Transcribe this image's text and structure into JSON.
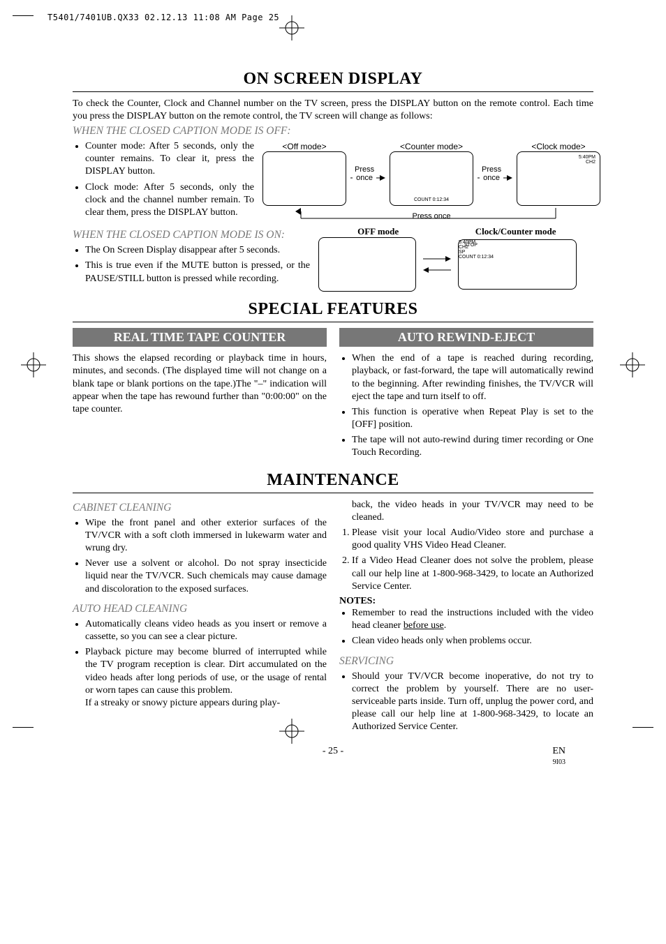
{
  "header": {
    "proof_line": "T5401/7401UB.QX33  02.12.13  11:08 AM  Page 25"
  },
  "sections": {
    "osd": {
      "title": "ON SCREEN DISPLAY",
      "intro": "To check the Counter, Clock and Channel number on the TV screen, press the DISPLAY button on the remote control. Each time you press the DISPLAY button on the remote control, the TV screen will change as follows:",
      "cc_off_heading": "WHEN THE CLOSED CAPTION MODE IS OFF:",
      "cc_off_bullets": [
        "Counter mode: After 5 seconds, only the counter remains. To clear it, press the DISPLAY button.",
        "Clock mode: After 5 seconds, only the clock and the channel number remain. To clear them, press the DISPLAY button."
      ],
      "cc_on_heading": "WHEN THE CLOSED CAPTION MODE IS ON:",
      "cc_on_bullets": [
        "The On Screen Display disappear after 5 seconds.",
        "This is true even if the MUTE button is pressed, or the PAUSE/STILL button is pressed while recording."
      ],
      "diagram": {
        "off_mode": "<Off mode>",
        "counter_mode": "<Counter mode>",
        "clock_mode": "<Clock mode>",
        "press_once": "Press once",
        "press_once_inline1": "Press",
        "press_once_inline2": "once",
        "count_readout": "COUNT  0:12:34",
        "clock_readout_time": "5:40PM",
        "clock_readout_ch": "CH2",
        "off_mode_bold": "OFF mode",
        "clock_counter_bold": "Clock/Counter mode",
        "stop": "STOP",
        "sp": "SP"
      }
    },
    "special": {
      "title": "SPECIAL FEATURES",
      "left_header": "REAL TIME TAPE COUNTER",
      "left_body": "This shows the elapsed recording or playback time in hours, minutes, and seconds. (The displayed time will not change on a blank tape or blank portions on the tape.)The \"–\" indication will appear when the tape has rewound further than \"0:00:00\" on the tape counter.",
      "right_header": "AUTO REWIND-EJECT",
      "right_bullets": [
        "When the end of a tape is reached during recording, playback, or fast-forward, the tape will automatically rewind to the beginning. After rewinding finishes, the TV/VCR will eject the tape and turn itself to off.",
        "This function is operative when Repeat Play is set to the [OFF] position.",
        "The tape will not auto-rewind during timer recording or One Touch Recording."
      ]
    },
    "maint": {
      "title": "MAINTENANCE",
      "cabinet_heading": "CABINET CLEANING",
      "cabinet_bullets": [
        "Wipe the front panel and other exterior surfaces of the TV/VCR with a soft cloth immersed in lukewarm water and wrung dry.",
        "Never use a solvent or alcohol. Do not spray insecticide liquid near the TV/VCR. Such chemicals may cause damage and discoloration to the exposed surfaces."
      ],
      "autohead_heading": "AUTO HEAD CLEANING",
      "autohead_bullets": [
        "Automatically cleans video heads as you insert or remove a cassette, so you can see a clear picture.",
        "Playback picture may become blurred of interrupted while the TV program reception is clear. Dirt accumulated on the video heads after long periods of use, or the usage of rental or worn tapes can cause this problem."
      ],
      "autohead_tail": "If a streaky or snowy picture appears during play",
      "right_top_continuation": "back, the video heads in your TV/VCR may need to be cleaned.",
      "numbered": [
        "Please visit your local Audio/Video store and purchase a good quality VHS Video Head Cleaner.",
        "If a Video Head Cleaner does not solve the problem, please call our help line at 1-800-968-3429, to locate an Authorized Service Center."
      ],
      "notes_label": "NOTES:",
      "notes_bullets_pre": "Remember to read the instructions included with the video head cleaner ",
      "notes_bullets_underline": "before use",
      "notes_bullets_post": ".",
      "notes_bullet2": "Clean video heads only when problems occur.",
      "servicing_heading": "SERVICING",
      "servicing_bullet": "Should your TV/VCR become inoperative, do not try to correct the problem by yourself. There are no user-serviceable parts inside. Turn off, unplug the power cord, and please call our help line at 1-800-968-3429, to locate an Authorized Service Center."
    }
  },
  "footer": {
    "page_num": "- 25 -",
    "lang": "EN",
    "doc_id": "9I03"
  }
}
